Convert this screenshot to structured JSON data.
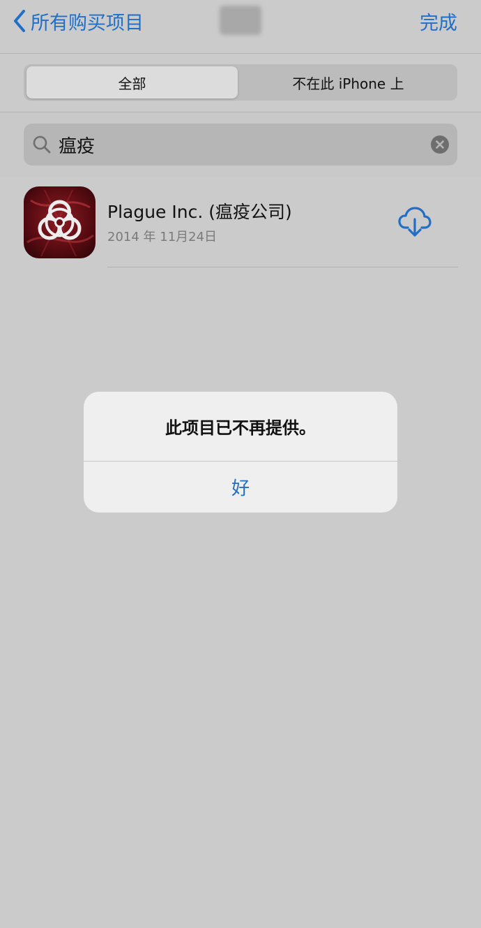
{
  "nav": {
    "back_label": "所有购买项目",
    "done_label": "完成"
  },
  "segments": [
    {
      "label": "全部",
      "selected": true
    },
    {
      "label": "不在此 iPhone 上",
      "selected": false
    }
  ],
  "search": {
    "value": "瘟疫"
  },
  "results": [
    {
      "name": "Plague Inc. (瘟疫公司)",
      "date": "2014 年 11月24日",
      "action_icon": "cloud-download-icon"
    }
  ],
  "alert": {
    "message": "此项目已不再提供。",
    "button": "好"
  },
  "colors": {
    "accent": "#1f6fc8",
    "background": "#cbcbcb"
  }
}
